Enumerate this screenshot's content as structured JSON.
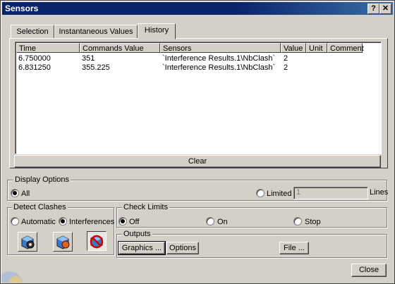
{
  "window": {
    "title": "Sensors",
    "help_label": "?",
    "close_label": "✕"
  },
  "tabs": [
    {
      "label": "Selection",
      "active": false
    },
    {
      "label": "Instantaneous Values",
      "active": false
    },
    {
      "label": "History",
      "active": true
    }
  ],
  "table": {
    "columns": [
      "Time",
      "Commands Value",
      "Sensors",
      "Value",
      "Unit",
      "Comment"
    ],
    "rows": [
      {
        "time": "6.750000",
        "commands_value": "351",
        "sensor": "`Interference Results.1\\NbClash`",
        "value": "2",
        "unit": "",
        "comment": ""
      },
      {
        "time": "6.831250",
        "commands_value": "355.225",
        "sensor": "`Interference Results.1\\NbClash`",
        "value": "2",
        "unit": "",
        "comment": ""
      }
    ]
  },
  "clear_label": "Clear",
  "display_options": {
    "title": "Display Options",
    "all_label": "All",
    "limited_label": "Limited",
    "limited_value": "1",
    "lines_label": "Lines",
    "selected": "All"
  },
  "detect_clashes": {
    "title": "Detect Clashes",
    "automatic_label": "Automatic",
    "interferences_label": "Interferences",
    "selected": "Interferences",
    "icons": [
      "clash-detection-on-icon",
      "clash-detection-stop-icon",
      "clash-detection-off-icon"
    ]
  },
  "check_limits": {
    "title": "Check Limits",
    "off_label": "Off",
    "on_label": "On",
    "stop_label": "Stop",
    "selected": "Off"
  },
  "outputs": {
    "title": "Outputs",
    "graphics_label": "Graphics ...",
    "options_label": "Options",
    "file_label": "File ..."
  },
  "close_label": "Close"
}
